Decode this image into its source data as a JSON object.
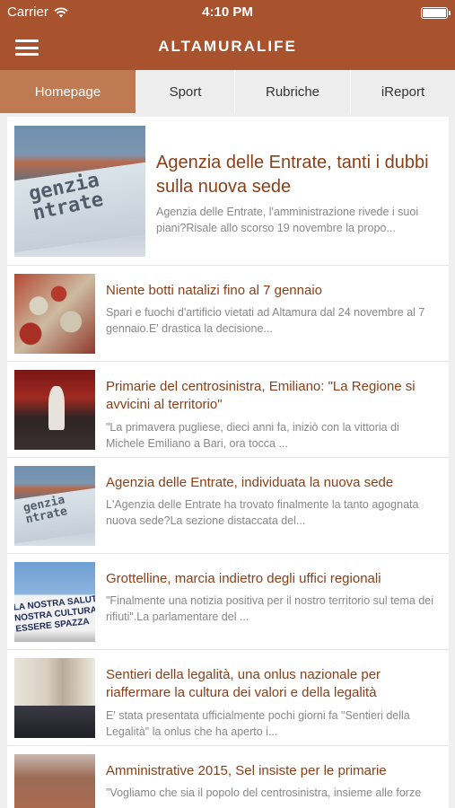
{
  "status_bar": {
    "carrier": "Carrier",
    "time": "4:10 PM"
  },
  "nav": {
    "title": "ALTAMURALIFE"
  },
  "tabs": [
    {
      "label": "Homepage",
      "active": true
    },
    {
      "label": "Sport",
      "active": false
    },
    {
      "label": "Rubriche",
      "active": false
    },
    {
      "label": "iReport",
      "active": false
    }
  ],
  "articles": [
    {
      "headline": "Agenzia delle Entrate, tanti i dubbi sulla nuova sede",
      "excerpt": "Agenzia delle Entrate, l'amministrazione rivede i suoi piani?Risale allo scorso 19 novembre la propo...",
      "thumb_text": "genzia\nntrate"
    },
    {
      "headline": "Niente botti natalizi fino al 7 gennaio",
      "excerpt": "Spari e fuochi d'artificio vietati ad Altamura dal 24 novembre al 7 gennaio.E' drastica la decisione..."
    },
    {
      "headline": "Primarie del centrosinistra, Emiliano: \"La Regione si avvicini al territorio\"",
      "excerpt": "\"La primavera pugliese, dieci anni fa, iniziò con la vittoria di Michele Emiliano a Bari, ora tocca ..."
    },
    {
      "headline": "Agenzia delle Entrate, individuata la nuova sede",
      "excerpt": "L'Agenzia delle Entrate ha trovato finalmente la tanto agognata nuova sede?La sezione distaccata del...",
      "thumb_text": "genzia\nntrate"
    },
    {
      "headline": "Grottelline, marcia indietro degli uffici regionali",
      "excerpt": "\"Finalmente una notizia positiva per il nostro territorio sul tema dei rifiuti\".La parlamentare del ...",
      "thumb_text": "LA NOSTRA SALUTE\nNOSTRA CULTURA\nESSERE SPAZZA"
    },
    {
      "headline": "Sentieri della legalità, una onlus nazionale per riaffermare la cultura dei valori e della legalità",
      "excerpt": "E' stata presentata ufficialmente pochi giorni fa \"Sentieri della Legalità\" la onlus che ha aperto i..."
    },
    {
      "headline": "Amministrative 2015, Sel insiste per le primarie",
      "excerpt": "\"Vogliamo che sia il popolo del centrosinistra, insieme alle forze"
    }
  ]
}
